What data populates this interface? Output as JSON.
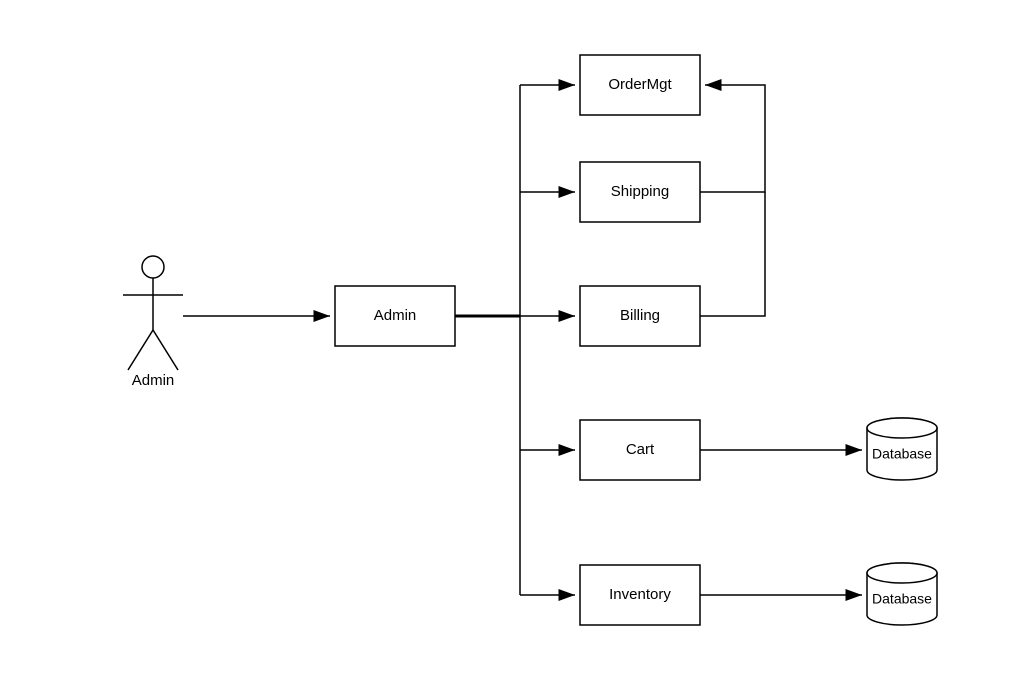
{
  "actor": {
    "label": "Admin"
  },
  "boxes": {
    "admin": "Admin",
    "ordermgt": "OrderMgt",
    "shipping": "Shipping",
    "billing": "Billing",
    "cart": "Cart",
    "inventory": "Inventory"
  },
  "databases": {
    "db1": "Database",
    "db2": "Database"
  }
}
